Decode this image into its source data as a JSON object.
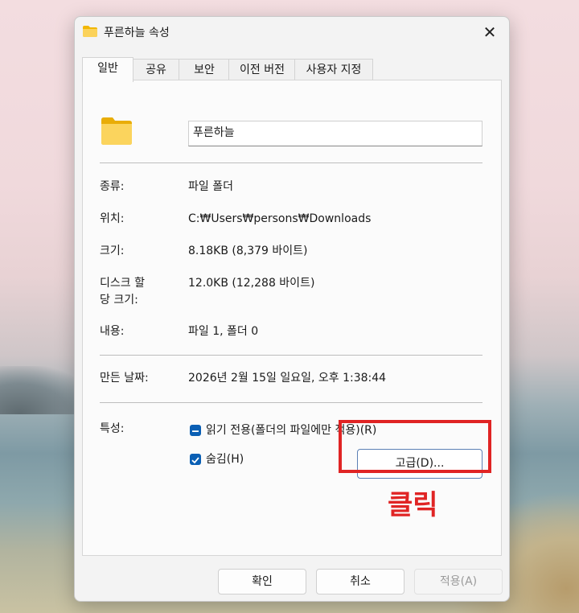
{
  "window": {
    "title": "푸른하늘 속성",
    "close_glyph": "✕"
  },
  "tabs": [
    {
      "label": "일반",
      "active": true
    },
    {
      "label": "공유"
    },
    {
      "label": "보안"
    },
    {
      "label": "이전 버전"
    },
    {
      "label": "사용자 지정"
    }
  ],
  "general": {
    "folder_name": "푸른하늘",
    "type_label": "종류:",
    "type_value": "파일 폴더",
    "location_label": "위치:",
    "location_value": "C:₩Users₩persons₩Downloads",
    "size_label": "크기:",
    "size_value": "8.18KB (8,379 바이트)",
    "disk_label_1": "디스크 할",
    "disk_label_2": "당 크기:",
    "disk_value": "12.0KB (12,288 바이트)",
    "contents_label": "내용:",
    "contents_value": "파일 1, 폴더 0",
    "created_label": "만든 날짜:",
    "created_value": "2026년 2월 15일 일요일, 오후 1:38:44",
    "attributes_label": "특성:",
    "readonly_label": "읽기 전용(폴더의 파일에만 적용)(R)",
    "hidden_label": "숨김(H)",
    "advanced_label": "고급(D)..."
  },
  "footer": {
    "ok_label": "확인",
    "cancel_label": "취소",
    "apply_label": "적용(A)"
  },
  "annotation": {
    "text": "클릭",
    "color": "#e02424"
  },
  "colors": {
    "accent": "#0a5fb4",
    "folder": "#f5c542"
  }
}
